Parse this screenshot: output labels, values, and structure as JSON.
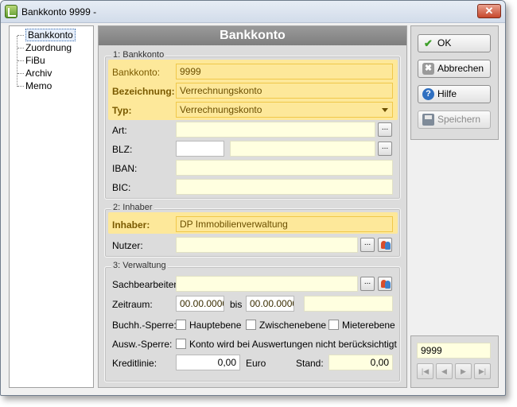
{
  "window": {
    "title": "Bankkonto 9999 -",
    "close_label": "✕"
  },
  "tree": {
    "items": [
      "Bankkonto",
      "Zuordnung",
      "FiBu",
      "Archiv",
      "Memo"
    ],
    "selected": "Bankkonto"
  },
  "main": {
    "header": "Bankkonto",
    "group1": {
      "title": "1: Bankkonto",
      "bankkonto_label": "Bankkonto:",
      "bankkonto_value": "9999",
      "bezeichnung_label": "Bezeichnung:",
      "bezeichnung_value": "Verrechnungskonto",
      "typ_label": "Typ:",
      "typ_value": "Verrechnungskonto",
      "art_label": "Art:",
      "art_value": "",
      "blz_label": "BLZ:",
      "blz_value": "",
      "blz_name": "",
      "iban_label": "IBAN:",
      "iban_value": "",
      "bic_label": "BIC:",
      "bic_value": "",
      "browse_label": "..."
    },
    "group2": {
      "title": "2: Inhaber",
      "inhaber_label": "Inhaber:",
      "inhaber_value": "DP Immobilienverwaltung",
      "nutzer_label": "Nutzer:",
      "nutzer_value": "",
      "browse_label": "..."
    },
    "group3": {
      "title": "3: Verwaltung",
      "sachbearbeiter_label": "Sachbearbeiter:",
      "sachbearbeiter_value": "",
      "zeitraum_label": "Zeitraum:",
      "zeitraum_from": "00.00.0000",
      "zeitraum_bis": "bis",
      "zeitraum_to": "00.00.0000",
      "zeitraum_extra": "",
      "buchh_sperre_label": "Buchh.-Sperre:",
      "hauptebene_label": "Hauptebene",
      "zwischenebene_label": "Zwischenebene",
      "mieterebene_label": "Mieterebene",
      "ausw_sperre_label": "Ausw.-Sperre:",
      "ausw_checkbox_label": "Konto wird bei Auswertungen nicht berücksichtigt",
      "kreditlinie_label": "Kreditlinie:",
      "kreditlinie_value": "0,00",
      "currency": "Euro",
      "stand_label": "Stand:",
      "stand_value": "0,00",
      "browse_label": "..."
    }
  },
  "buttons": {
    "ok": "OK",
    "abbrechen": "Abbrechen",
    "hilfe": "Hilfe",
    "speichern": "Speichern",
    "ok_icon": "✔",
    "cancel_icon": "✖",
    "help_icon": "?"
  },
  "navigator": {
    "record_value": "9999",
    "first": "|◀",
    "prev": "◀",
    "next": "▶",
    "last": "▶|"
  },
  "colors": {
    "required_highlight": "#fde89a",
    "field_background": "#ffffe0",
    "header_gray": "#8a8a8a"
  }
}
